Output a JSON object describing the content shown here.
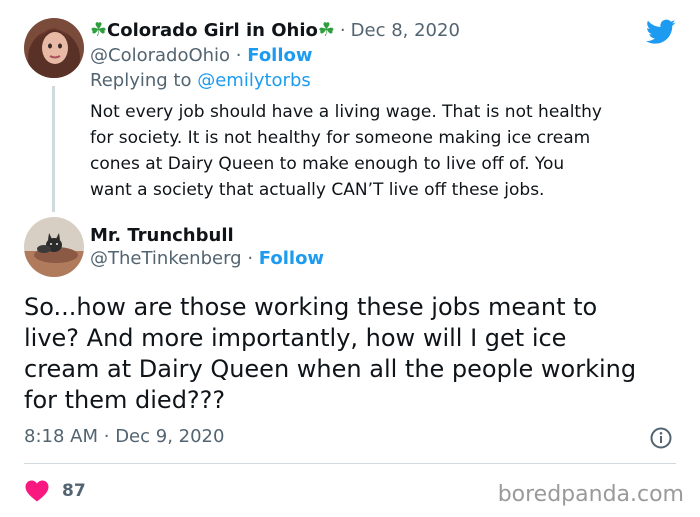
{
  "tweet1": {
    "display_name": "Colorado Girl in Ohio",
    "name_emoji": "☘",
    "date": "Dec 8, 2020",
    "handle": "@ColoradoOhio",
    "follow_label": "Follow",
    "replying_prefix": "Replying to",
    "replying_to": "@emilytorbs",
    "text": "Not every job should have a living wage. That is not healthy\nfor society. It is not healthy for someone making ice cream\ncones at Dairy Queen to make enough to live off of.  You\nwant a society that actually CAN’T live off these jobs."
  },
  "tweet2": {
    "display_name": "Mr. Trunchbull",
    "handle": "@TheTinkenberg",
    "follow_label": "Follow",
    "text": "So...how are those working these jobs meant to\nlive? And more importantly, how will I get ice\ncream at Dairy Queen when all the people working\nfor them died???",
    "time": "8:18 AM",
    "date": "Dec 9, 2020",
    "like_count": "87"
  },
  "watermark": "boredpanda.com",
  "colors": {
    "twitter_blue": "#1d9bf0",
    "heart_red": "#f91880",
    "divider": "#cfd9de"
  },
  "icons": [
    "twitter-bird-icon",
    "info-icon",
    "heart-icon"
  ]
}
